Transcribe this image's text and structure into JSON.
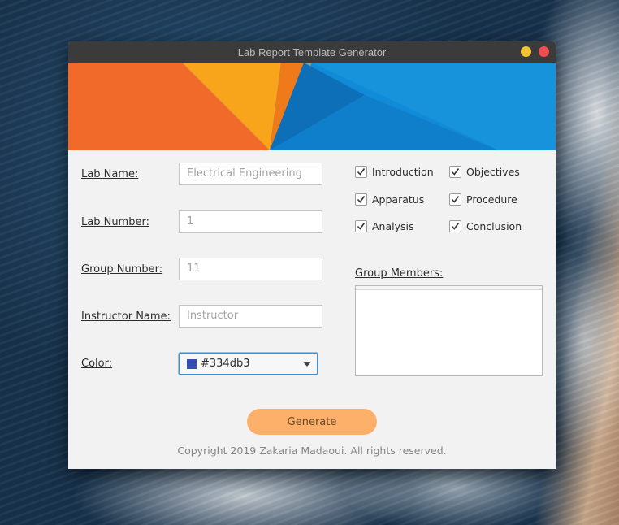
{
  "window": {
    "title": "Lab Report Template Generator"
  },
  "form": {
    "lab_name_label": "Lab Name:",
    "lab_name_value": "Electrical Engineering",
    "lab_number_label": "Lab Number:",
    "lab_number_value": "1",
    "group_number_label": "Group Number:",
    "group_number_value": "11",
    "instructor_name_label": "Instructor Name:",
    "instructor_name_value": "Instructor",
    "color_label": "Color:",
    "color_value": "#334db3",
    "color_swatch": "#334db3"
  },
  "sections": [
    {
      "label": "Introduction",
      "checked": true
    },
    {
      "label": "Objectives",
      "checked": true
    },
    {
      "label": "Apparatus",
      "checked": true
    },
    {
      "label": "Procedure",
      "checked": true
    },
    {
      "label": "Analysis",
      "checked": true
    },
    {
      "label": "Conclusion",
      "checked": true
    }
  ],
  "group_members": {
    "label": "Group Members:",
    "value": ""
  },
  "generate_label": "Generate",
  "copyright": "Copyright 2019 Zakaria Madaoui. All rights reserved.",
  "colors": {
    "accent_button": "#fdb069",
    "banner_blue": "#118ad8",
    "banner_orange": "#f26a2a",
    "banner_yellow": "#f8a51c",
    "minimize": "#f4c233",
    "close": "#ed4f4f"
  }
}
